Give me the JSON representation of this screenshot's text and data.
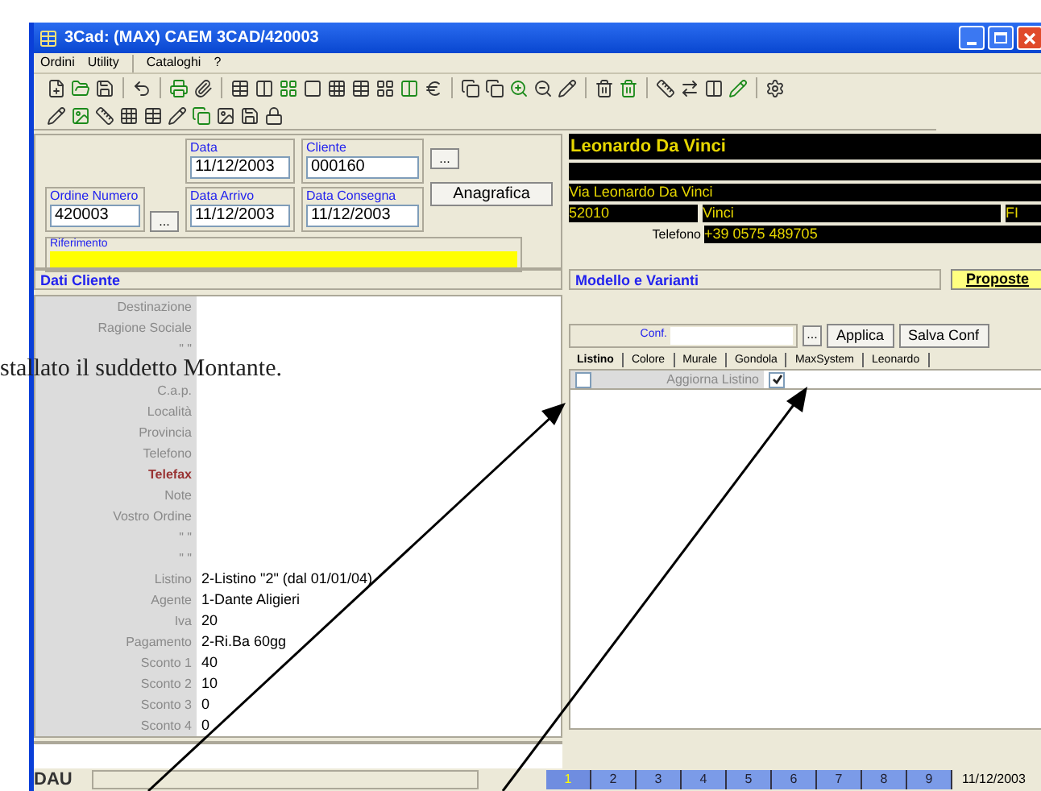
{
  "window": {
    "title": "3Cad: (MAX) CAEM 3CAD/420003"
  },
  "menu": [
    "Ordini",
    "Utility",
    "Cataloghi",
    "?"
  ],
  "order": {
    "numero": {
      "label": "Ordine Numero",
      "value": "420003"
    },
    "data": {
      "label": "Data",
      "value": "11/12/2003"
    },
    "cliente": {
      "label": "Cliente",
      "value": "000160"
    },
    "data_arrivo": {
      "label": "Data Arrivo",
      "value": "11/12/2003"
    },
    "data_consegna": {
      "label": "Data Consegna",
      "value": "11/12/2003"
    },
    "browse_buttons": [
      "...",
      "..."
    ],
    "anagrafica_button": "Anagrafica",
    "riferimento_label": "Riferimento"
  },
  "customer_card": {
    "name": "Leonardo Da Vinci",
    "address": "Via Leonardo Da Vinci",
    "cap": "52010",
    "city": "Vinci",
    "province": "FI",
    "phone_label": "Telefono",
    "phone": "+39 0575 489705"
  },
  "dati_cliente": {
    "title": "Dati Cliente",
    "rows": [
      {
        "label": "Destinazione"
      },
      {
        "label": "Ragione Sociale"
      },
      {
        "label": "\"       \""
      },
      {},
      {
        "label": "C.a.p."
      },
      {
        "label": "Località"
      },
      {
        "label": "Provincia"
      },
      {
        "label": "Telefono"
      },
      {
        "label": "Telefax",
        "color": "#993333"
      },
      {
        "label": "Note"
      },
      {
        "label": "Vostro Ordine"
      },
      {
        "label": "\"       \""
      },
      {
        "label": "\"       \""
      },
      {
        "label": "Listino",
        "value": "2-Listino \"2\" (dal 01/01/04)"
      },
      {
        "label": "Agente",
        "value": "1-Dante Aligieri"
      },
      {
        "label": "Iva",
        "value": "20"
      },
      {
        "label": "Pagamento",
        "value": "2-Ri.Ba 60gg"
      },
      {
        "label": "Sconto 1",
        "value": "40"
      },
      {
        "label": "Sconto 2",
        "value": "10"
      },
      {
        "label": "Sconto 3",
        "value": "0"
      },
      {
        "label": "Sconto 4",
        "value": "0"
      }
    ]
  },
  "modello": {
    "title": "Modello e Varianti",
    "proposte_button": "Proposte",
    "conf_label": "Conf.",
    "browse_button": "...",
    "buttons": [
      "Applica",
      "Salva Conf"
    ],
    "tabs": [
      {
        "label": "Listino",
        "selected": true
      },
      {
        "label": "Colore",
        "selected": false
      },
      {
        "label": "Murale",
        "selected": false
      },
      {
        "label": "Gondola",
        "selected": false
      },
      {
        "label": "MaxSystem",
        "selected": false
      },
      {
        "label": "Leonardo",
        "selected": false
      }
    ],
    "options": [
      {
        "label": "Aggiorna Listino",
        "row_checked": false,
        "checked": true
      }
    ]
  },
  "document_overlay": {
    "text": "stallato il suddetto Montante."
  },
  "status_bar": {
    "logo": "DAU",
    "pages": [
      {
        "label": "1",
        "selected": true
      },
      {
        "label": "2",
        "selected": false
      },
      {
        "label": "3",
        "selected": false
      },
      {
        "label": "4",
        "selected": false
      },
      {
        "label": "5",
        "selected": false
      },
      {
        "label": "6",
        "selected": false
      },
      {
        "label": "7",
        "selected": false
      },
      {
        "label": "8",
        "selected": false
      },
      {
        "label": "9",
        "selected": false
      }
    ],
    "date": "11/12/2003"
  }
}
